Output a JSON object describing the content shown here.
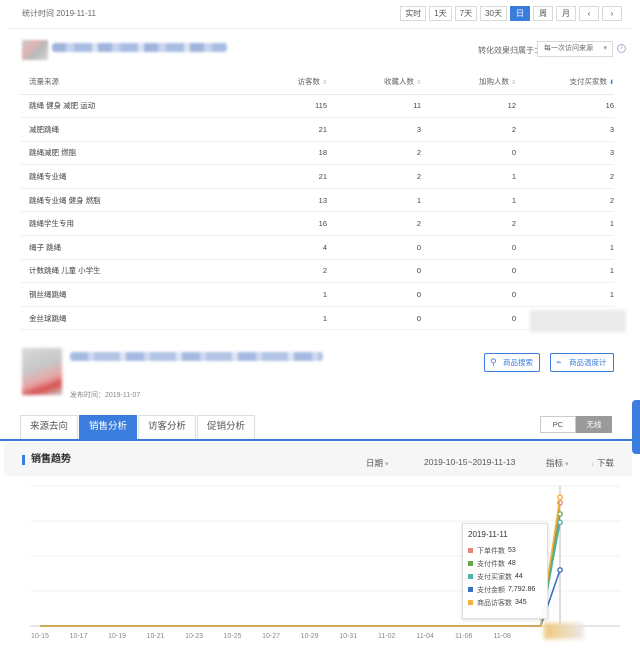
{
  "header": {
    "stat_time": "统计时间 2019-11-11",
    "periods": [
      {
        "label": "实时",
        "active": false
      },
      {
        "label": "1天",
        "active": false
      },
      {
        "label": "7天",
        "active": false
      },
      {
        "label": "30天",
        "active": false
      },
      {
        "label": "日",
        "active": true
      },
      {
        "label": "周",
        "active": false
      },
      {
        "label": "月",
        "active": false
      }
    ],
    "prev": "‹",
    "next": "›"
  },
  "conversion": {
    "label": "转化效果归属于：",
    "selected": "每一次访问来源",
    "arrow": "▾",
    "info": "i"
  },
  "source_table": {
    "columns": [
      "流量来源",
      "访客数",
      "收藏人数",
      "加购人数",
      "支付买家数"
    ],
    "sort_marks": [
      "",
      "⇕",
      "⇕",
      "⇕",
      "⬇"
    ],
    "rows": [
      [
        "跳绳 健身 减肥 运动",
        "115",
        "11",
        "12",
        "16"
      ],
      [
        "减肥跳绳",
        "21",
        "3",
        "2",
        "3"
      ],
      [
        "跳绳减肥 燃脂",
        "18",
        "2",
        "0",
        "3"
      ],
      [
        "跳绳专业绳",
        "21",
        "2",
        "1",
        "2"
      ],
      [
        "跳绳专业绳 健身 燃脂",
        "13",
        "1",
        "1",
        "2"
      ],
      [
        "跳绳学生专用",
        "16",
        "2",
        "2",
        "1"
      ],
      [
        "绳子 跳绳",
        "4",
        "0",
        "0",
        "1"
      ],
      [
        "计数跳绳 儿童 小学生",
        "2",
        "0",
        "0",
        "1"
      ],
      [
        "钢丝绳跳绳",
        "1",
        "0",
        "0",
        "1"
      ],
      [
        "金丝球跳绳",
        "1",
        "0",
        "0",
        ""
      ]
    ]
  },
  "product": {
    "publish_time": "发布时间：2019-11-07",
    "search_btn": "商品搜索",
    "temp_btn": "商品温度计",
    "search_icon": "magnifier-icon",
    "temp_icon": "link-icon"
  },
  "tabs": [
    {
      "label": "来源去向",
      "active": false
    },
    {
      "label": "销售分析",
      "active": true
    },
    {
      "label": "访客分析",
      "active": false
    },
    {
      "label": "促销分析",
      "active": false
    }
  ],
  "platform": [
    {
      "label": "PC",
      "active": false
    },
    {
      "label": "无线",
      "active": true
    }
  ],
  "trend": {
    "title": "销售趋势",
    "granularity": "日期",
    "range": "2019-10-15~2019-11-13",
    "metrics": "指标",
    "download": "下载",
    "dd": "▾",
    "download_icon": "↓"
  },
  "chart_data": {
    "type": "line",
    "x": [
      "10-15",
      "10-17",
      "10-19",
      "10-21",
      "10-23",
      "10-25",
      "10-27",
      "10-29",
      "10-31",
      "11-02",
      "11-04",
      "11-06",
      "11-08"
    ],
    "x_dates": [
      "10-15",
      "10-16",
      "10-17",
      "10-18",
      "10-19",
      "10-20",
      "10-21",
      "10-22",
      "10-23",
      "10-24",
      "10-25",
      "10-26",
      "10-27",
      "10-28",
      "10-29",
      "10-30",
      "10-31",
      "11-01",
      "11-02",
      "11-03",
      "11-04",
      "11-05",
      "11-06",
      "11-07",
      "11-08",
      "11-09",
      "11-10",
      "11-11"
    ],
    "series": [
      {
        "name": "下单件数",
        "color": "#e8867a",
        "values": [
          0,
          0,
          0,
          0,
          0,
          0,
          0,
          0,
          0,
          0,
          0,
          0,
          0,
          0,
          0,
          0,
          0,
          0,
          0,
          0,
          0,
          0,
          0,
          0,
          0,
          0,
          0,
          53
        ]
      },
      {
        "name": "支付件数",
        "color": "#6aa84f",
        "values": [
          0,
          0,
          0,
          0,
          0,
          0,
          0,
          0,
          0,
          0,
          0,
          0,
          0,
          0,
          0,
          0,
          0,
          0,
          0,
          0,
          0,
          0,
          0,
          0,
          0,
          0,
          0,
          48
        ]
      },
      {
        "name": "支付买家数",
        "color": "#4fb3a6",
        "values": [
          0,
          0,
          0,
          0,
          0,
          0,
          0,
          0,
          0,
          0,
          0,
          0,
          0,
          0,
          0,
          0,
          0,
          0,
          0,
          0,
          0,
          0,
          0,
          0,
          0,
          0,
          0,
          44
        ]
      },
      {
        "name": "支付金额",
        "color": "#3b6fc4",
        "values": [
          0,
          0,
          0,
          0,
          0,
          0,
          0,
          0,
          0,
          0,
          0,
          0,
          0,
          0,
          0,
          0,
          0,
          0,
          0,
          0,
          0,
          0,
          0,
          0,
          0,
          0,
          0,
          7792.86
        ]
      },
      {
        "name": "商品访客数",
        "color": "#f4b13c",
        "values": [
          0,
          0,
          0,
          0,
          0,
          0,
          0,
          0,
          0,
          0,
          0,
          0,
          0,
          0,
          0,
          0,
          0,
          0,
          0,
          0,
          0,
          0,
          0,
          0,
          0,
          0,
          0,
          345
        ]
      }
    ],
    "tooltip": {
      "date": "2019-11-11",
      "values": [
        "53",
        "48",
        "44",
        "7,792.86",
        "345"
      ]
    }
  }
}
